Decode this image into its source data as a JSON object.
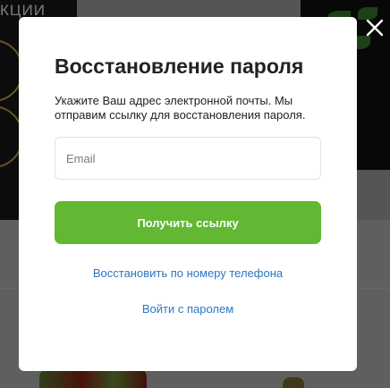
{
  "background": {
    "banner_text": "КЦИИ"
  },
  "modal": {
    "title": "Восстановление пароля",
    "description": "Укажите Ваш адрес электронной почты. Мы отправим ссылку для восстановления пароля.",
    "email_placeholder": "Email",
    "email_value": "",
    "submit_label": "Получить ссылку",
    "restore_by_phone_label": "Восстановить по номеру телефона",
    "login_with_password_label": "Войти с паролем"
  },
  "icons": {
    "close": "close-icon"
  },
  "colors": {
    "primary_button": "#62b832",
    "link": "#2a77c5",
    "overlay": "rgba(0,0,0,0.38)"
  }
}
